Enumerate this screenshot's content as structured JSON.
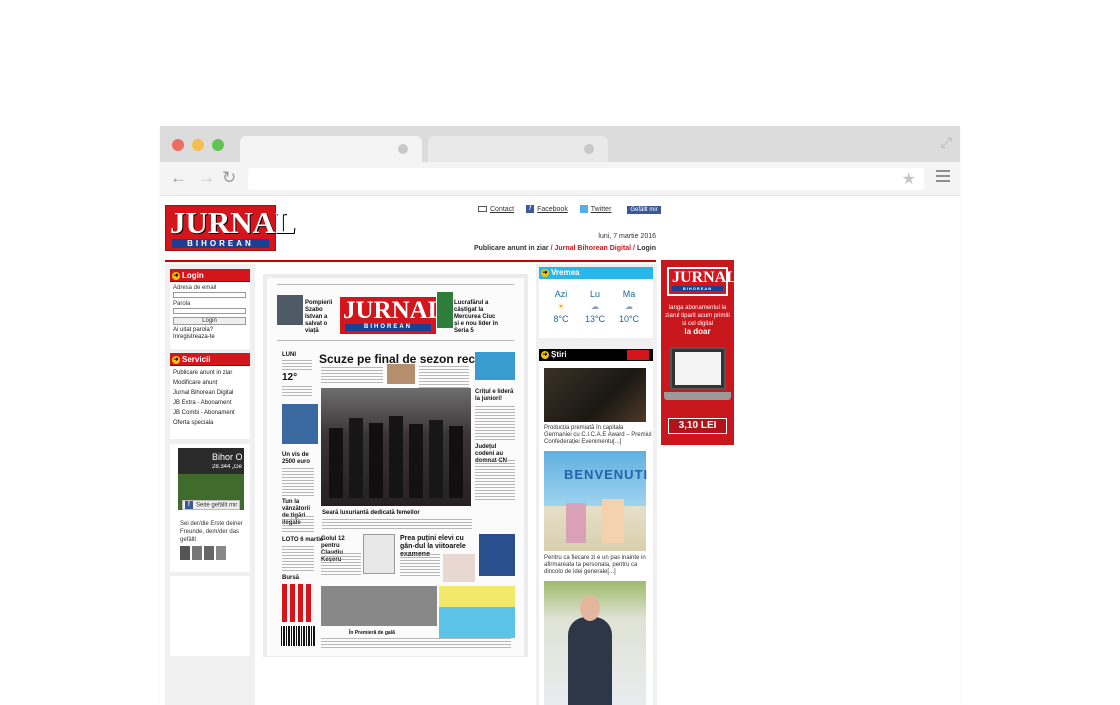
{
  "browser": {
    "url": ""
  },
  "site": {
    "logo_main": "JURNAL",
    "logo_sub": "BIHOREAN",
    "top_links": {
      "contact": "Contact",
      "facebook": "Facebook",
      "twitter": "Twitter",
      "fb_like": "Gefällt mir"
    },
    "date": "luni, 7 martie 2016",
    "nav": {
      "publicare": "Publicare anunt in ziar",
      "sep1": " / ",
      "digital": "Jurnal Bihorean Digital",
      "sep2": " / ",
      "login": "Login"
    }
  },
  "login_box": {
    "title": "Login",
    "email_label": "Adresa de email",
    "password_label": "Parola",
    "button": "Login",
    "forgot": "Ai uitat parola?",
    "register": "Inregistreaza-te"
  },
  "services": {
    "title": "Servicii",
    "items": [
      "Publicare anunt in ziar",
      "Modificare anunț",
      "Jurnal Bihorean Digital",
      "JB Extra - Abonament",
      "JB Combi - Abonament",
      "Oferta speciala"
    ]
  },
  "fb_widget": {
    "page_title": "Bihor O...",
    "likes": "28.344 „Gefäll",
    "like_button": "Seite gefällt mir",
    "text": "Sei der/die Erste deiner Freunde, dem/der das gefällt"
  },
  "newspaper": {
    "logo_main": "JURNAL",
    "logo_sub": "BIHOREAN",
    "headline": "Scuze pe final de sezon rece",
    "side_left": "Pompierii Szabo Istvan a salvat o viață",
    "side_right": "Lucrafărul a câștigat la Mercurea Ciuc și e nou lider în Seria 5",
    "day": "LUNI",
    "temperature": "12°",
    "visit": "Un vis de 2500 euro",
    "tun": "Tun la vânzătorii de țigări ilegale",
    "lotto": "LOTO 6 martie",
    "bursa": "Bursă",
    "event": "Seară luxuriantă dedicată femeilor",
    "gol": "Golul 12 pentru Claudiu Keșeru",
    "prea": "Prea puțini elevi cu gân-dul la viitoarele examene",
    "critul": "Crițul e lideră la juniori!",
    "judetul": "Județul codeni au domnat CN",
    "premiera": "În Premieră de gală"
  },
  "weather": {
    "title": "Vremea",
    "days": [
      {
        "name": "Azi",
        "icon": "sun-cloud-icon",
        "temp": "8°C"
      },
      {
        "name": "Lu",
        "icon": "rain-cloud-icon",
        "temp": "13°C"
      },
      {
        "name": "Ma",
        "icon": "rain-cloud-icon",
        "temp": "10°C"
      }
    ]
  },
  "news": {
    "title": "Știri",
    "items": [
      {
        "caption": "Producția premiată în capitala Germaniei cu C.I.C.A.E Award – Premiul Confederației Evenimentu[...]"
      },
      {
        "caption": "Pentru ca fiecare zi e un pas inainte in afirmareata ta personala, pentru ca dincolo de idei generale[...]",
        "image_text": "BENVENUTI"
      },
      {
        "caption": ""
      }
    ]
  },
  "ad": {
    "logo_main": "JURNAL",
    "logo_sub": "BIHOREAN",
    "text": "langa abonamentul la ziarul tiparit acum primiti si cel digital",
    "text_bold": "la doar",
    "price": "3,10 LEI"
  },
  "colors": {
    "brand_red": "#d4161c",
    "brand_blue": "#1c3f94",
    "weather_blue": "#29b6e8"
  }
}
